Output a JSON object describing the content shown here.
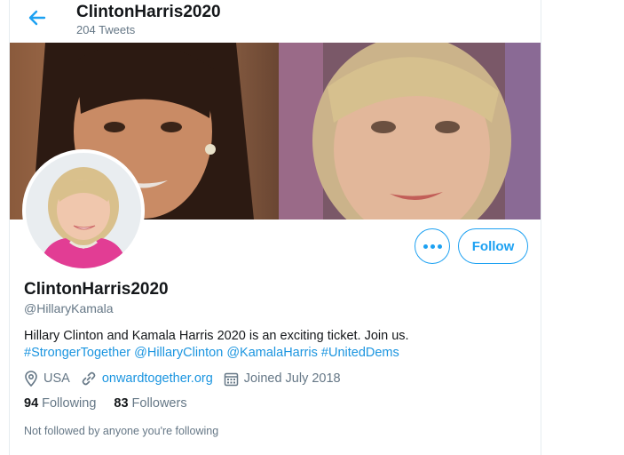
{
  "header": {
    "title": "ClintonHarris2020",
    "tweet_count": "204 Tweets"
  },
  "profile": {
    "display_name": "ClintonHarris2020",
    "handle": "@HillaryKamala",
    "bio_text": "Hillary Clinton and Kamala Harris 2020 is an exciting ticket. Join us.",
    "hashtags": [
      "#StrongerTogether",
      "@HillaryClinton",
      "@KamalaHarris",
      "#UnitedDems"
    ],
    "location": "USA",
    "website": "onwardtogether.org",
    "joined": "Joined July 2018",
    "following_count": "94",
    "following_label": "Following",
    "followers_count": "83",
    "followers_label": "Followers",
    "followed_note": "Not followed by anyone you're following"
  },
  "actions": {
    "follow_label": "Follow"
  },
  "icons": {
    "back": "arrow-left-icon",
    "more": "more-dots-icon",
    "location": "location-pin-icon",
    "link": "link-icon",
    "calendar": "calendar-icon"
  },
  "colors": {
    "accent": "#1da1f2",
    "link": "#1b95e0",
    "secondary_text": "#657786"
  }
}
